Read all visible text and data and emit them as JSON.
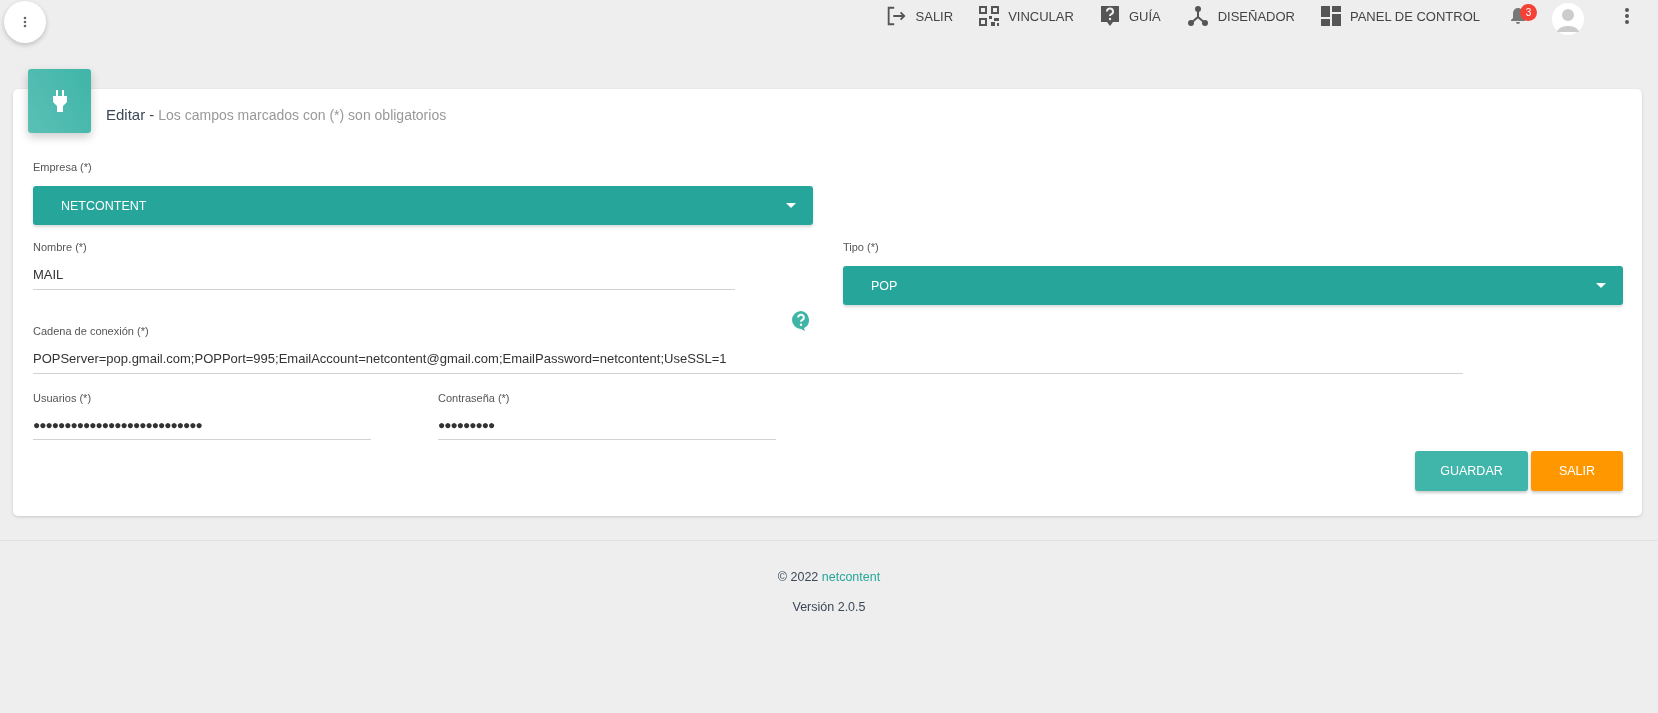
{
  "topbar": {
    "items": [
      {
        "kind": "exit",
        "label": "SALIR"
      },
      {
        "kind": "qr",
        "label": "VINCULAR"
      },
      {
        "kind": "help",
        "label": "GUÍA"
      },
      {
        "kind": "designer",
        "label": "DISEÑADOR"
      },
      {
        "kind": "dashboard",
        "label": "PANEL DE CONTROL"
      }
    ],
    "notifications": "3"
  },
  "card": {
    "title": "Editar",
    "separator": "-",
    "subtitle": "Los campos marcados con (*) son obligatorios",
    "empresa": {
      "label": "Empresa (*)",
      "value": "NETCONTENT"
    },
    "nombre": {
      "label": "Nombre (*)",
      "value": "MAIL"
    },
    "tipo": {
      "label": "Tipo (*)",
      "value": "POP"
    },
    "cadena": {
      "label": "Cadena de conexión (*)",
      "value": "POPServer=pop.gmail.com;POPPort=995;EmailAccount=netcontent@gmail.com;EmailPassword=netcontent;UseSSL=1"
    },
    "usuarios": {
      "label": "Usuarios (*)",
      "value": "●●●●●●●●●●●●●●●●●●●●●●●●●●●"
    },
    "contrasena": {
      "label": "Contraseña (*)",
      "value": "●●●●●●●●●"
    },
    "buttons": [
      {
        "kind": "primary",
        "label": "GUARDAR"
      },
      {
        "kind": "warning",
        "label": "SALIR"
      }
    ]
  },
  "footer": {
    "copyright": "© 2022",
    "brand": "netcontent",
    "version": "Versión 2.0.5"
  }
}
